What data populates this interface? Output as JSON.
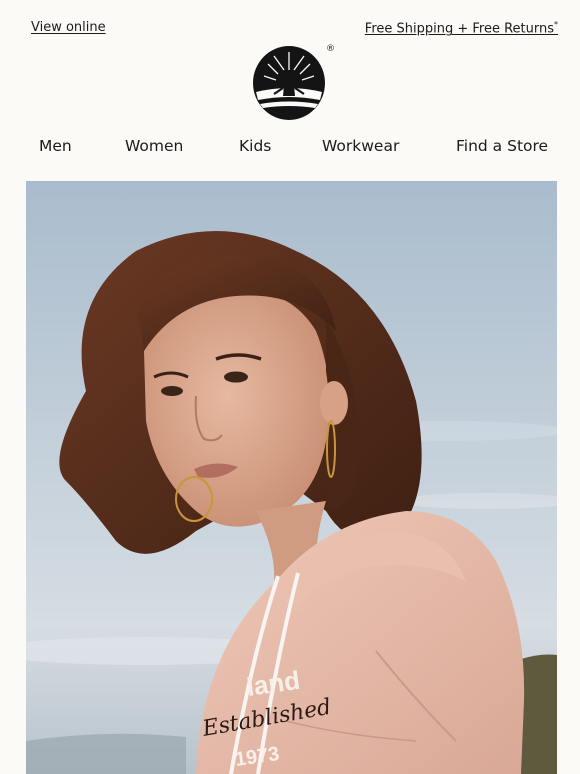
{
  "header": {
    "view_online": "View online",
    "shipping": "Free Shipping + Free Returns",
    "shipping_mark": "*",
    "registered_mark": "®"
  },
  "logo": {
    "icon": "timberland-tree-icon"
  },
  "nav": {
    "items": [
      {
        "label": "Men"
      },
      {
        "label": "Women"
      },
      {
        "label": "Kids"
      },
      {
        "label": "Workwear"
      },
      {
        "label": "Find a Store"
      }
    ]
  },
  "hero": {
    "sweatshirt_print": [
      "land",
      "Established",
      "1973"
    ]
  },
  "colors": {
    "text": "#1b1b1b",
    "background": "#fbfaf7",
    "sky": "#b9c7d3",
    "hoodie": "#e4b6a6",
    "hair": "#5a3020"
  }
}
